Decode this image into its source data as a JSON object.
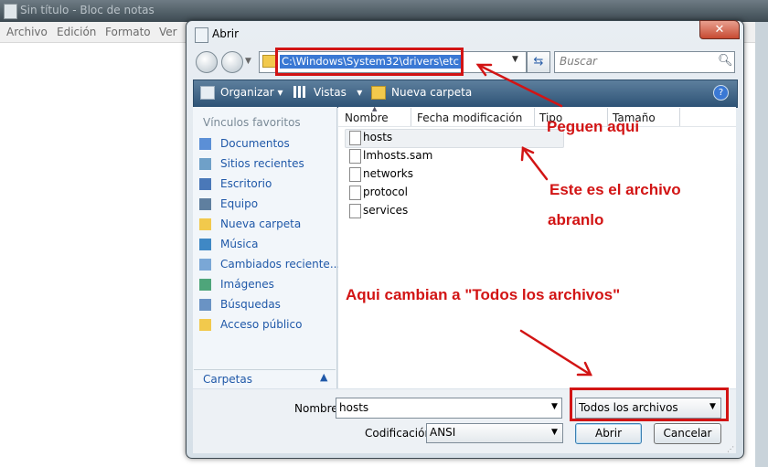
{
  "notepad": {
    "title": "Sin título - Bloc de notas",
    "menu": [
      "Archivo",
      "Edición",
      "Formato",
      "Ver"
    ]
  },
  "dialog": {
    "title": "Abrir",
    "close_symbol": "✕",
    "address": "C:\\Windows\\System32\\drivers\\etc",
    "search_placeholder": "Buscar",
    "toolbar": {
      "organize": "Organizar",
      "views": "Vistas",
      "new_folder": "Nueva carpeta"
    },
    "favorites_header": "Vínculos favoritos",
    "favorites": [
      {
        "label": "Documentos",
        "icon": "documents-icon"
      },
      {
        "label": "Sitios recientes",
        "icon": "recent-places-icon"
      },
      {
        "label": "Escritorio",
        "icon": "desktop-icon"
      },
      {
        "label": "Equipo",
        "icon": "computer-icon"
      },
      {
        "label": "Nueva carpeta",
        "icon": "folder-icon"
      },
      {
        "label": "Música",
        "icon": "music-icon"
      },
      {
        "label": "Cambiados reciente...",
        "icon": "recently-changed-icon"
      },
      {
        "label": "Imágenes",
        "icon": "pictures-icon"
      },
      {
        "label": "Búsquedas",
        "icon": "searches-icon"
      },
      {
        "label": "Acceso público",
        "icon": "public-folder-icon"
      }
    ],
    "folders_label": "Carpetas",
    "columns": [
      "Nombre",
      "Fecha modificación",
      "Tipo",
      "Tamaño"
    ],
    "files": [
      "hosts",
      "lmhosts.sam",
      "networks",
      "protocol",
      "services"
    ],
    "name_label": "Nombre:",
    "name_value": "hosts",
    "file_type": "Todos los archivos",
    "encoding_label": "Codificación:",
    "encoding_value": "ANSI",
    "open_button": "Abrir",
    "cancel_button": "Cancelar",
    "help_symbol": "?"
  },
  "annotations": {
    "paste_here": "Peguen aqui",
    "this_file": "Este es el archivo",
    "open_it": "abranlo",
    "change_type": "Aqui cambian a \"Todos los archivos\""
  },
  "colors": {
    "annotation_red": "#d21414",
    "toolbar_blue": "#2e5376",
    "link_blue": "#1f58a8",
    "selection_blue": "#3a78d4"
  }
}
